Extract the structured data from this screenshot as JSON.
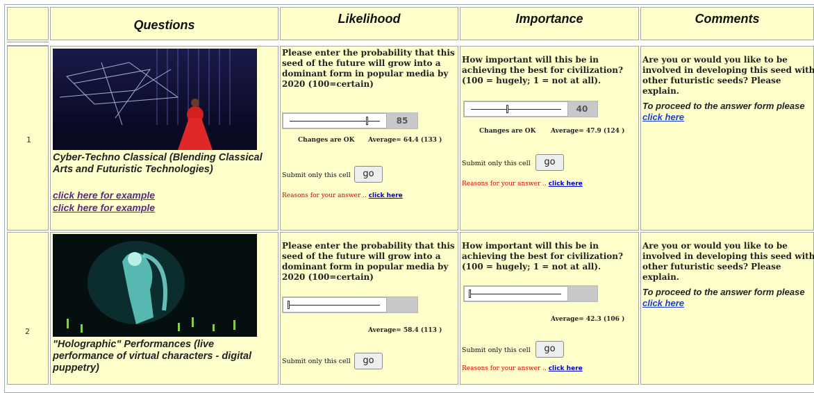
{
  "headers": {
    "questions": "Questions",
    "likelihood": "Likelihood",
    "importance": "Importance",
    "comments": "Comments"
  },
  "rows": [
    {
      "number": "1",
      "title": "Cyber-Techno Classical (Blending Classical Arts and Futuristic Technologies)",
      "links": [
        "click here for example",
        "click here for example"
      ],
      "likelihood": {
        "prompt": "Please enter the probability that this seed of the future will grow into a dominant form in popular media by 2020 (100=certain)",
        "value": "85",
        "value_fraction": 0.85,
        "changes": "Changes are OK",
        "average": "Average= 64.4 (133 )",
        "submit_label": "Submit only this cell",
        "go": "go",
        "reasons": "Reasons for your answer .. ",
        "reasons_link": "click here"
      },
      "importance": {
        "prompt": "How important will this be in achieving the best for civilization? (100 = hugely; 1 = not at all).",
        "value": "40",
        "value_fraction": 0.4,
        "changes": "Changes are OK",
        "average": "Average= 47.9 (124 )",
        "submit_label": "Submit only this cell",
        "go": "go",
        "reasons": "Reasons for your answer .. ",
        "reasons_link": "click here"
      },
      "comments": {
        "text": "Are you or would you like to be involved in developing this seed with other futuristic seeds? Please explain.",
        "proceed": "To proceed to the answer form please ",
        "proceed_link": "click here"
      }
    },
    {
      "number": "2",
      "title": "\"Holographic\" Performances (live performance of virtual characters - digital puppetry)",
      "links": [],
      "likelihood": {
        "prompt": "Please enter the probability that this seed of the future will grow into a dominant form in popular media by 2020 (100=certain)",
        "value": "",
        "value_fraction": 0.0,
        "changes": "",
        "average": "Average= 58.4 (113 )",
        "submit_label": "Submit only this cell",
        "go": "go"
      },
      "importance": {
        "prompt": "How important will this be in achieving the best for civilization? (100 = hugely; 1 = not at all).",
        "value": "",
        "value_fraction": 0.0,
        "changes": "",
        "average": "Average= 42.3 (106 )",
        "submit_label": "Submit only this cell",
        "go": "go",
        "reasons": "Reasons for your answer .. ",
        "reasons_link": "click here"
      },
      "comments": {
        "text": "Are you or would you like to be involved in developing this seed with other futuristic seeds? Please explain.",
        "proceed": "To proceed to the answer form please ",
        "proceed_link": "click here"
      }
    }
  ]
}
